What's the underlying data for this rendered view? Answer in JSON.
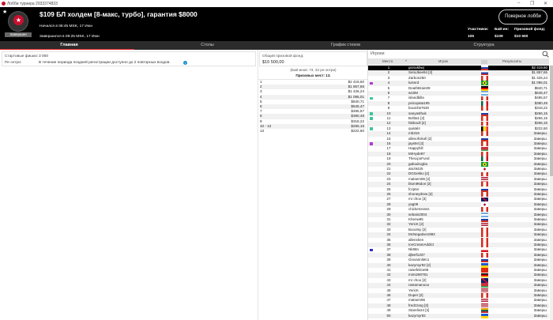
{
  "window": {
    "title": "Лобби турнира 2933374833",
    "minimize": "–",
    "maximize": "❐",
    "close": "✕"
  },
  "header": {
    "title": "$109 БЛ холдем [8-макс, турбо], гарантия $8000",
    "started": "Начался в 06:45 MSK, 17 Июн",
    "finished": "Завершился в 09:25 MSK, 17 Июн",
    "status": "Завершен",
    "lobby_button": "Покерное лобби",
    "stats": [
      {
        "label": "Участники:",
        "value": "105"
      },
      {
        "label": "Бай-ин:",
        "value": "$109"
      },
      {
        "label": "Призовой фонд:",
        "value": "$10 500"
      }
    ]
  },
  "tabs": [
    {
      "label": "Главная",
      "active": true
    },
    {
      "label": "Столы"
    },
    {
      "label": "График стеков"
    },
    {
      "label": "Структура"
    }
  ],
  "info": {
    "chips_label": "Стартовые фишки:",
    "chips_value": "3 000",
    "reentry_label": "Ре-энтри:",
    "reentry_value": "В течение периода поздней регистрации доступно до 2 повторных входов."
  },
  "prize": {
    "pool_label": "Общий призовой фонд:",
    "pool_value": "$10 500,00",
    "buyins": "(Бай-инов: 73, 32 ре-энтри)",
    "places": "Призовых мест: 13.",
    "rows": [
      [
        "1",
        "$2 419,60"
      ],
      [
        "2",
        "$1 857,65"
      ],
      [
        "3",
        "$1 426,24"
      ],
      [
        "4",
        "$1 095,01"
      ],
      [
        "5",
        "$840,71"
      ],
      [
        "6",
        "$645,47"
      ],
      [
        "7",
        "$495,57"
      ],
      [
        "8",
        "$380,48"
      ],
      [
        "9",
        "$318,22"
      ],
      [
        "10 - 12",
        "$266,15"
      ],
      [
        "13",
        "$222,60"
      ]
    ]
  },
  "players": {
    "title": "Игроки",
    "columns": {
      "place": "Место",
      "player": "Игрок",
      "results": "Результаты"
    },
    "colors": {
      "purple": "#b03ad0",
      "teal": "#3cc4a0",
      "blue": "#3030c0"
    },
    "rows": [
      [
        "1",
        "gsrsxkbwj",
        "ru",
        "$2 419,60",
        ""
      ],
      [
        "2",
        "SeraJkee94 [2]",
        "ru",
        "$1 857,65",
        ""
      ],
      [
        "3",
        "Zarbon250",
        "ca",
        "$1 426,24",
        ""
      ],
      [
        "4",
        "luisnrd",
        "br",
        "$1 095,01",
        "purple"
      ],
      [
        "5",
        "DeathBrain09",
        "de",
        "$840,71",
        ""
      ],
      [
        "6",
        "w10M",
        "ar",
        "$645,47",
        ""
      ],
      [
        "7",
        "islandbilla",
        "ca",
        "$495,57",
        "teal"
      ],
      [
        "8",
        "psicopata195",
        "mx",
        "$380,48",
        ""
      ],
      [
        "9",
        "boutch67630",
        "ca",
        "$318,22",
        ""
      ],
      [
        "10",
        "sanyasthuk",
        "ru",
        "$266,15",
        "teal"
      ],
      [
        "11",
        "Boltta1 [2]",
        "ca",
        "$266,15",
        "teal"
      ],
      [
        "12",
        "hbiboull [2]",
        "ca",
        "$266,15",
        ""
      ],
      [
        "13",
        "quatal4",
        "be",
        "$222,60",
        "teal"
      ],
      [
        "14",
        "mb319",
        "ca",
        "Заверш.",
        ""
      ],
      [
        "15",
        "allesofnikoll [2]",
        "ru",
        "Заверш.",
        ""
      ],
      [
        "16",
        "jays94 [2]",
        "ca",
        "Заверш.",
        "purple"
      ],
      [
        "17",
        "Happyhill",
        "by",
        "Заверш.",
        ""
      ],
      [
        "18",
        "MrHyde97",
        "ca",
        "Заверш.",
        ""
      ],
      [
        "19",
        "TheLipoFund",
        "mx",
        "Заверш.",
        ""
      ],
      [
        "20",
        "gabodrogba",
        "br",
        "Заверш.",
        ""
      ],
      [
        "21",
        "atoz9425",
        "jp",
        "Заверш.",
        ""
      ],
      [
        "22",
        "DGGekko [2]",
        "ca",
        "Заверш.",
        ""
      ],
      [
        "23",
        "matsem96 [2]",
        "us",
        "Заверш.",
        ""
      ],
      [
        "24",
        "blum96don [2]",
        "ca",
        "Заверш.",
        ""
      ],
      [
        "25",
        "fczpter",
        "ru",
        "Заверш.",
        ""
      ],
      [
        "26",
        "shoneydrew [2]",
        "ca",
        "Заверш.",
        ""
      ],
      [
        "27",
        "mr choo [3]",
        "gb",
        "Заверш.",
        ""
      ],
      [
        "28",
        "yag09",
        "jp",
        "Заверш.",
        ""
      ],
      [
        "29",
        "chickensssss",
        "ca",
        "Заверш.",
        ""
      ],
      [
        "30",
        "sebain2004",
        "ar",
        "Заверш.",
        ""
      ],
      [
        "31",
        "Khenw95",
        "ru",
        "Заверш.",
        ""
      ],
      [
        "32",
        "YericK [2]",
        "us",
        "Заверш.",
        ""
      ],
      [
        "33",
        "Boootsy [2]",
        "ca",
        "Заверш.",
        ""
      ],
      [
        "34",
        "McNegative1992",
        "ca",
        "Заверш.",
        ""
      ],
      [
        "35",
        "allenshen",
        "ca",
        "Заверш.",
        ""
      ],
      [
        "36",
        "IceCreamAddict",
        "ca",
        "Заверш.",
        ""
      ],
      [
        "37",
        "Nk88n",
        "cz",
        "Заверш.",
        "blue"
      ],
      [
        "38",
        "djleef1337",
        "ca",
        "Заверш.",
        ""
      ],
      [
        "39",
        "GiovanniMc1",
        "ru",
        "Заверш.",
        ""
      ],
      [
        "40",
        "kazymyr92 [2]",
        "ua",
        "Заверш.",
        ""
      ],
      [
        "41",
        "raisefelice88",
        "cn",
        "Заверш.",
        ""
      ],
      [
        "42",
        "mimi290781",
        "de",
        "Заверш.",
        ""
      ],
      [
        "43",
        "mr choo [2]",
        "gb",
        "Заверш.",
        ""
      ],
      [
        "44",
        "rastamanooo",
        "by",
        "Заверш.",
        ""
      ],
      [
        "45",
        "YericK",
        "us",
        "Заверш.",
        ""
      ],
      [
        "46",
        "Duper [2]",
        "ca",
        "Заверш.",
        ""
      ],
      [
        "47",
        "matsem96",
        "us",
        "Заверш.",
        ""
      ],
      [
        "48",
        "fredzzarg [3]",
        "us",
        "Заверш.",
        ""
      ],
      [
        "49",
        "Starelis24 [2]",
        "lt",
        "Заверш.",
        ""
      ],
      [
        "50",
        "kazymyr92",
        "ua",
        "Заверш.",
        ""
      ]
    ]
  }
}
